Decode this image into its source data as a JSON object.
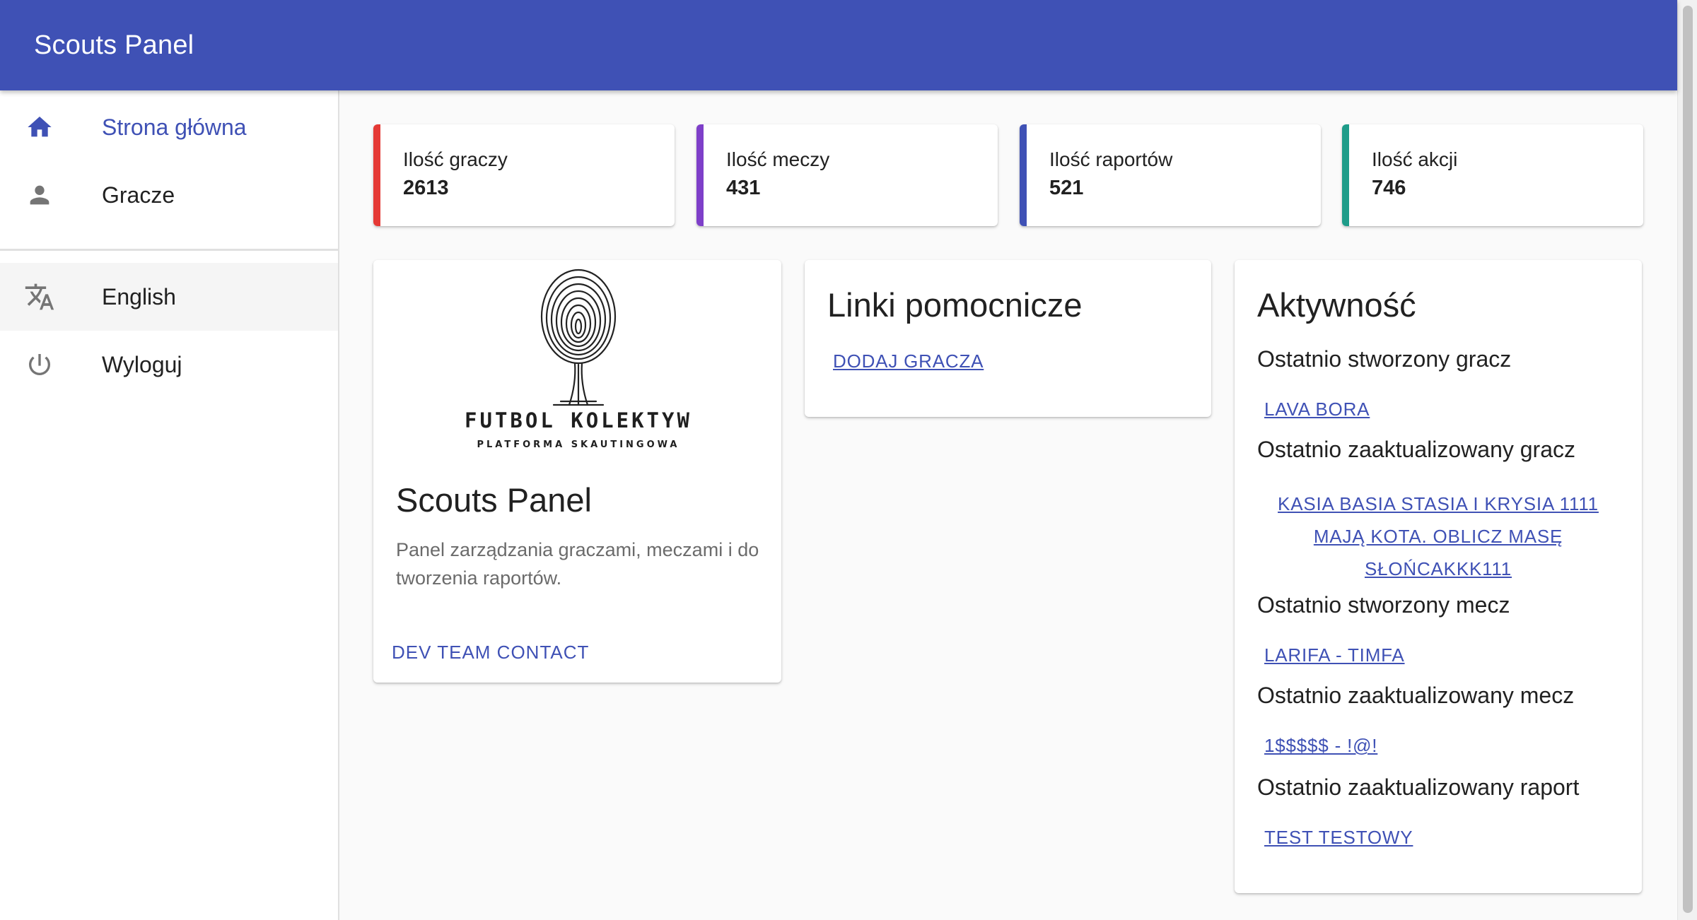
{
  "app": {
    "title": "Scouts Panel"
  },
  "sidebar": {
    "items": [
      {
        "label": "Strona główna",
        "icon": "home-icon",
        "active": true
      },
      {
        "label": "Gracze",
        "icon": "person-icon",
        "active": false
      },
      {
        "label": "English",
        "icon": "translate-icon",
        "active": false
      },
      {
        "label": "Wyloguj",
        "icon": "power-icon",
        "active": false
      }
    ]
  },
  "stats": [
    {
      "label": "Ilość graczy",
      "value": "2613",
      "color": "#e53935"
    },
    {
      "label": "Ilość meczy",
      "value": "431",
      "color": "#7e3fc9"
    },
    {
      "label": "Ilość raportów",
      "value": "521",
      "color": "#3f51b5"
    },
    {
      "label": "Ilość akcji",
      "value": "746",
      "color": "#1e9c89"
    }
  ],
  "about_card": {
    "logo_line1": "FUTBOL KOLEKTYW",
    "logo_line2": "PLATFORMA SKAUTINGOWA",
    "title": "Scouts Panel",
    "description": "Panel zarządzania graczami, meczami i do tworzenia raportów.",
    "button": "Dev team contact"
  },
  "links_card": {
    "title": "Linki pomocnicze",
    "links": [
      "Dodaj gracza"
    ]
  },
  "activity_card": {
    "title": "Aktywność",
    "sections": [
      {
        "label": "Ostatnio stworzony gracz",
        "link": "Lava Bora"
      },
      {
        "label": "Ostatnio zaaktualizowany gracz",
        "link": "KASIA BASIA STASIA I KRYSIA 1111 MAJĄ KOTA. OBLICZ MASĘ SŁOŃCAKKK111"
      },
      {
        "label": "Ostatnio stworzony mecz",
        "link": "LARIFA - TIMFA"
      },
      {
        "label": "Ostatnio zaaktualizowany mecz",
        "link": "1$$$$$ - !@!"
      },
      {
        "label": "Ostatnio zaaktualizowany raport",
        "link": "TEST TESTOWY"
      }
    ]
  },
  "colors": {
    "primary": "#3f51b5"
  }
}
